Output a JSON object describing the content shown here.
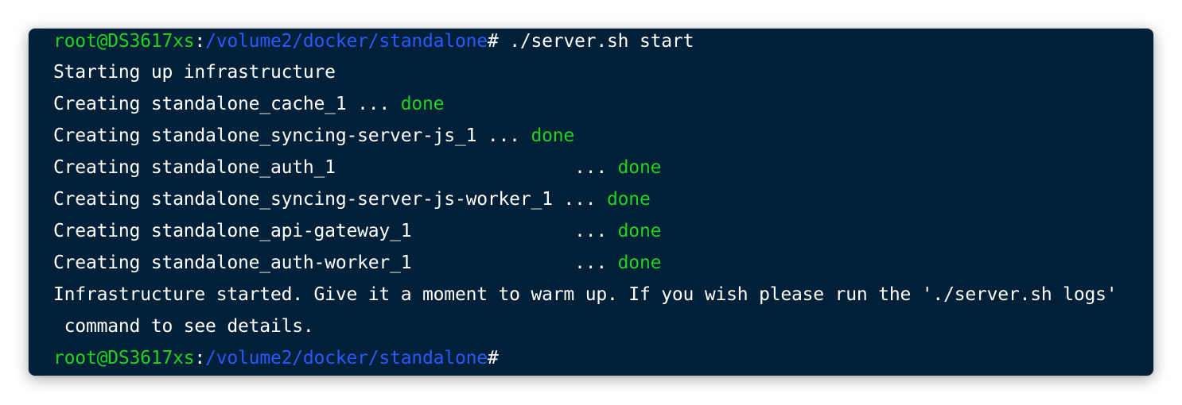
{
  "terminal": {
    "prompt1": {
      "user": "root@DS3617xs",
      "colon": ":",
      "path": "/volume2/docker/standalone",
      "hash": "#",
      "command": " ./server.sh start"
    },
    "line_start": "Starting up infrastructure",
    "create_lines": [
      {
        "text": "Creating standalone_cache_1 ... ",
        "status": "done"
      },
      {
        "text": "Creating standalone_syncing-server-js_1 ... ",
        "status": "done"
      },
      {
        "text": "Creating standalone_auth_1                      ... ",
        "status": "done"
      },
      {
        "text": "Creating standalone_syncing-server-js-worker_1 ... ",
        "status": "done"
      },
      {
        "text": "Creating standalone_api-gateway_1               ... ",
        "status": "done"
      },
      {
        "text": "Creating standalone_auth-worker_1               ... ",
        "status": "done"
      }
    ],
    "info_line1": "Infrastructure started. Give it a moment to warm up. If you wish please run the './server.sh logs'",
    "info_line2": " command to see details.",
    "prompt2": {
      "user": "root@DS3617xs",
      "colon": ":",
      "path": "/volume2/docker/standalone",
      "hash": "#"
    },
    "colors": {
      "background": "#022038",
      "user": "#1fd31f",
      "path": "#2759ff",
      "text": "#ffffff",
      "done": "#1fd31f"
    }
  }
}
